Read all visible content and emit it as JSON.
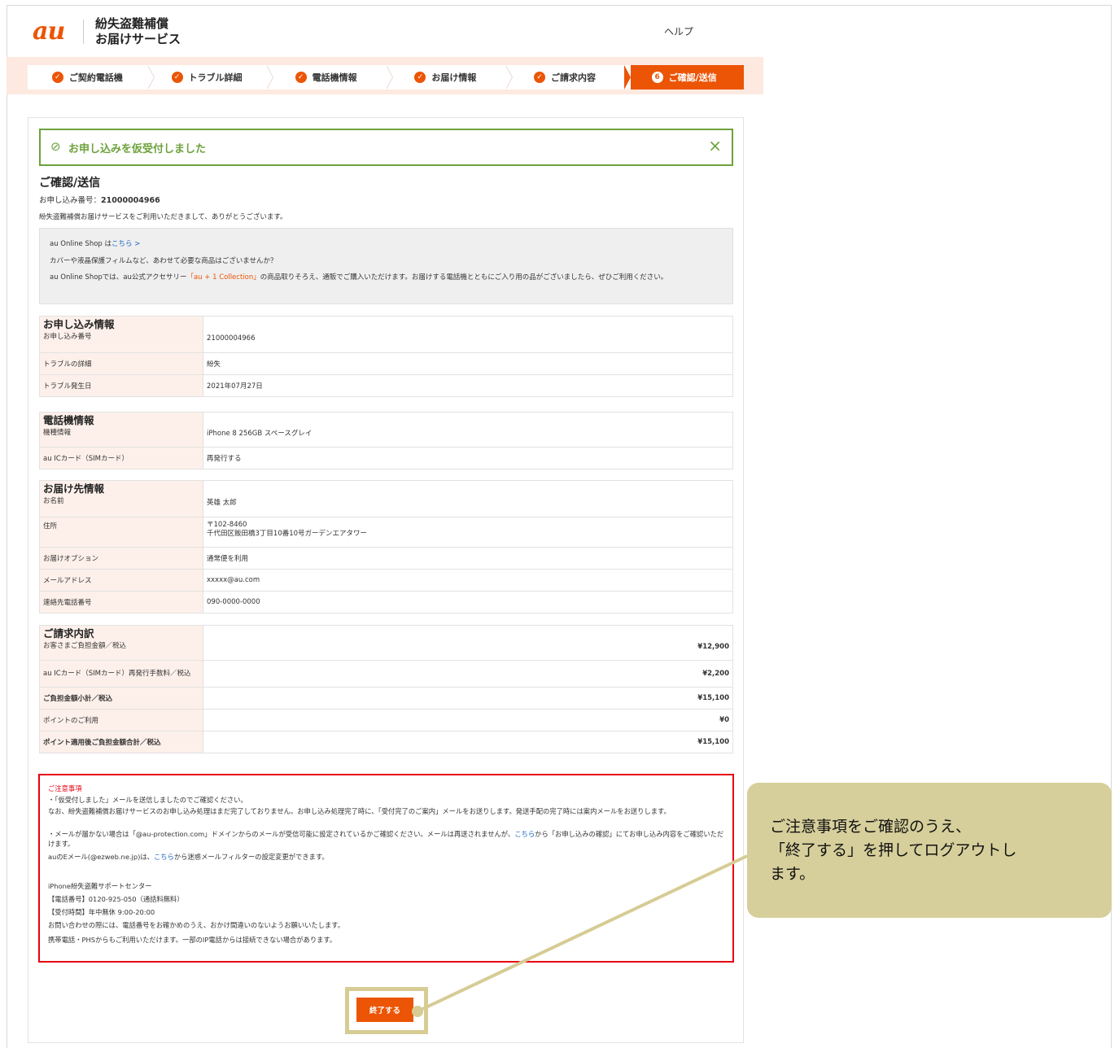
{
  "header": {
    "logo": "au",
    "service_name_line1": "紛失盗難補償",
    "service_name_line2": "お届けサービス",
    "help": "ヘルプ"
  },
  "steps": [
    {
      "label": "ご契約電話機",
      "icon": "✓"
    },
    {
      "label": "トラブル詳細",
      "icon": "✓"
    },
    {
      "label": "電話機情報",
      "icon": "✓"
    },
    {
      "label": "お届け情報",
      "icon": "✓"
    },
    {
      "label": "ご請求内容",
      "icon": "✓"
    },
    {
      "label": "ご確認/送信",
      "icon": "6",
      "active": true
    }
  ],
  "banner": {
    "icon": "check-circle-icon",
    "text": "お申し込みを仮受付しました",
    "close": "×"
  },
  "page": {
    "title": "ご確認/送信",
    "app_number_label": "お申し込み番号：",
    "app_number": "21000004966",
    "thanks": "紛失盗難補償お届けサービスをご利用いただきまして、ありがとうございます。"
  },
  "promo": {
    "line1_prefix": "au Online Shop は",
    "line1_link": "こちら >",
    "line2": "カバーや液晶保護フィルムなど、あわせて必要な商品はございませんか？",
    "line3_prefix": "au Online Shopでは、au公式アクセサリー",
    "line3_link": "「au + 1 Collection」",
    "line3_suffix": "の商品取りそろえ、通販でご購入いただけます。お届けする電話機とともにご入り用の品がございましたら、ぜひご利用ください。"
  },
  "application_info": {
    "title": "お申し込み情報",
    "rows": [
      {
        "label": "お申し込み番号",
        "value": "21000004966"
      },
      {
        "label": "トラブルの詳細",
        "value": "紛失"
      },
      {
        "label": "トラブル発生日",
        "value": "2021年07月27日"
      }
    ]
  },
  "phone_info": {
    "title": "電話機情報",
    "rows": [
      {
        "label": "機種情報",
        "value": "iPhone 8 256GB スペースグレイ"
      },
      {
        "label": "au ICカード（SIMカード）",
        "value": "再発行する"
      }
    ]
  },
  "delivery_info": {
    "title": "お届け先情報",
    "rows": [
      {
        "label": "お名前",
        "value": "英雄 太郎"
      },
      {
        "label": "住所",
        "value": "〒102-8460",
        "value2": "千代田区飯田橋3丁目10番10号ガーデンエアタワー"
      },
      {
        "label": "お届けオプション",
        "value": "通常便を利用"
      },
      {
        "label": "メールアドレス",
        "value": "xxxxx@au.com"
      },
      {
        "label": "連絡先電話番号",
        "value": "090-0000-0000"
      }
    ]
  },
  "billing": {
    "title": "ご請求内訳",
    "rows": [
      {
        "label": "お客さまご負担金額／税込",
        "value": "¥12,900"
      },
      {
        "label": "au ICカード（SIMカード）再発行手数料／税込",
        "value": "¥2,200"
      },
      {
        "label": "ご負担金額小計／税込",
        "value": "¥15,100"
      },
      {
        "label": "ポイントのご利用",
        "value": "¥0"
      },
      {
        "label": "ポイント適用後ご負担金額合計／税込",
        "value": "¥15,100"
      }
    ]
  },
  "notes": {
    "title": "ご注意事項",
    "p1": "・「仮受付しました」メールを送信しましたのでご確認ください。",
    "p2": "なお、紛失盗難補償お届けサービスのお申し込み処理はまだ完了しておりません。お申し込み処理完了時に、「受付完了のご案内」メールをお送りします。発送手配の完了時には案内メールをお送りします。",
    "p3_prefix": "・メールが届かない場合は「@au-protection.com」ドメインからのメールが受信可能に設定されているかご確認ください。メールは再送されませんが、",
    "p3_link": "こちら",
    "p3_suffix": "から「お申し込みの確認」にてお申し込み内容をご確認いただけます。",
    "p4_prefix": "auのEメール(@ezweb.ne.jp)は、",
    "p4_link": "こちら",
    "p4_suffix": "から迷惑メールフィルターの設定変更ができます。",
    "p5": "iPhone紛失盗難サポートセンター",
    "p6": "【電話番号】0120-925-050（通話料無料）",
    "p7": "【受付時間】年中無休 9:00-20:00",
    "p8": "お問い合わせの際には、電話番号をお確かめのうえ、おかけ間違いのないようお願いいたします。",
    "p9": "携帯電話・PHSからもご利用いただけます。一部のIP電話からは接続できない場合があります。"
  },
  "finish_button": "終了する",
  "callout": {
    "line1": "ご注意事項をご確認のうえ、",
    "line2": "「終了する」を押してログアウトし",
    "line3": "ます。"
  },
  "colors": {
    "accent": "#eb5505",
    "success": "#6da23b",
    "warning": "#e60012",
    "callout": "#d6cf9b"
  }
}
